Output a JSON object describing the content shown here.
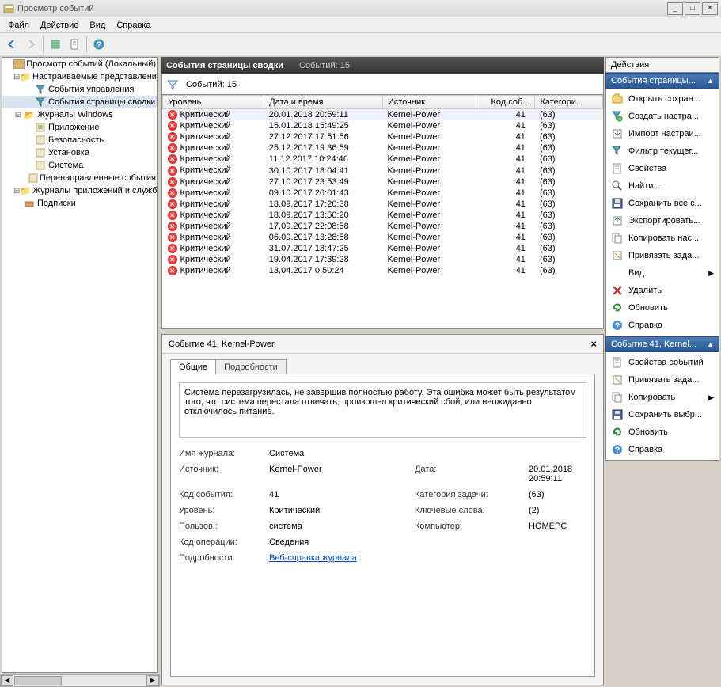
{
  "window": {
    "title": "Просмотр событий"
  },
  "menu": {
    "file": "Файл",
    "action": "Действие",
    "view": "Вид",
    "help": "Справка"
  },
  "tree": {
    "root": "Просмотр событий (Локальный)",
    "custom_views": "Настраиваемые представления",
    "admin_events": "События управления",
    "summary_events": "События страницы сводки",
    "windows_logs": "Журналы Windows",
    "application": "Приложение",
    "security": "Безопасность",
    "setup": "Установка",
    "system": "Система",
    "forwarded": "Перенаправленные события",
    "apps_services": "Журналы приложений и служб",
    "subscriptions": "Подписки"
  },
  "header": {
    "title": "События страницы сводки",
    "count_label": "Событий: 15"
  },
  "filter": {
    "count_label": "Событий: 15"
  },
  "columns": {
    "level": "Уровень",
    "datetime": "Дата и время",
    "source": "Источник",
    "event_id": "Код соб...",
    "category": "Категори..."
  },
  "rows": [
    {
      "level": "Критический",
      "datetime": "20.01.2018 20:59:11",
      "source": "Kernel-Power",
      "event_id": "41",
      "category": "(63)"
    },
    {
      "level": "Критический",
      "datetime": "15.01.2018 15:49:25",
      "source": "Kernel-Power",
      "event_id": "41",
      "category": "(63)"
    },
    {
      "level": "Критический",
      "datetime": "27.12.2017 17:51:56",
      "source": "Kernel-Power",
      "event_id": "41",
      "category": "(63)"
    },
    {
      "level": "Критический",
      "datetime": "25.12.2017 19:36:59",
      "source": "Kernel-Power",
      "event_id": "41",
      "category": "(63)"
    },
    {
      "level": "Критический",
      "datetime": "11.12.2017 10:24:46",
      "source": "Kernel-Power",
      "event_id": "41",
      "category": "(63)"
    },
    {
      "level": "Критический",
      "datetime": "30.10.2017 18:04:41",
      "source": "Kernel-Power",
      "event_id": "41",
      "category": "(63)"
    },
    {
      "level": "Критический",
      "datetime": "27.10.2017 23:53:49",
      "source": "Kernel-Power",
      "event_id": "41",
      "category": "(63)"
    },
    {
      "level": "Критический",
      "datetime": "09.10.2017 20:01:43",
      "source": "Kernel-Power",
      "event_id": "41",
      "category": "(63)"
    },
    {
      "level": "Критический",
      "datetime": "18.09.2017 17:20:38",
      "source": "Kernel-Power",
      "event_id": "41",
      "category": "(63)"
    },
    {
      "level": "Критический",
      "datetime": "18.09.2017 13:50:20",
      "source": "Kernel-Power",
      "event_id": "41",
      "category": "(63)"
    },
    {
      "level": "Критический",
      "datetime": "17.09.2017 22:08:58",
      "source": "Kernel-Power",
      "event_id": "41",
      "category": "(63)"
    },
    {
      "level": "Критический",
      "datetime": "06.09.2017 13:28:58",
      "source": "Kernel-Power",
      "event_id": "41",
      "category": "(63)"
    },
    {
      "level": "Критический",
      "datetime": "31.07.2017 18:47:25",
      "source": "Kernel-Power",
      "event_id": "41",
      "category": "(63)"
    },
    {
      "level": "Критический",
      "datetime": "19.04.2017 17:39:28",
      "source": "Kernel-Power",
      "event_id": "41",
      "category": "(63)"
    },
    {
      "level": "Критический",
      "datetime": "13.04.2017 0:50:24",
      "source": "Kernel-Power",
      "event_id": "41",
      "category": "(63)"
    }
  ],
  "detail": {
    "title": "Событие 41, Kernel-Power",
    "tab_general": "Общие",
    "tab_details": "Подробности",
    "description": "Система перезагрузилась, не завершив полностью работу. Эта ошибка может быть результатом того, что система перестала отвечать, произошел критический сбой, или неожиданно отключилось питание.",
    "labels": {
      "log_name": "Имя журнала:",
      "source": "Источник:",
      "event_id": "Код события:",
      "level": "Уровень:",
      "user": "Пользов.:",
      "opcode": "Код операции:",
      "more": "Подробности:",
      "date": "Дата:",
      "task_cat": "Категория задачи:",
      "keywords": "Ключевые слова:",
      "computer": "Компьютер:"
    },
    "values": {
      "log_name": "Система",
      "source": "Kernel-Power",
      "event_id": "41",
      "level": "Критический",
      "user": "система",
      "opcode": "Сведения",
      "more_link": "Веб-справка журнала",
      "date": "20.01.2018 20:59:11",
      "task_cat": "(63)",
      "keywords": "(2)",
      "computer": "HOMEPC"
    }
  },
  "actions": {
    "title": "Действия",
    "section1": "События страницы...",
    "items1": [
      "Открыть сохран...",
      "Создать настра...",
      "Импорт настраи...",
      "Фильтр текущег...",
      "Свойства",
      "Найти...",
      "Сохранить все с...",
      "Экспортировать...",
      "Копировать нас...",
      "Привязать зада...",
      "Вид",
      "Удалить",
      "Обновить",
      "Справка"
    ],
    "section2": "Событие 41, Kernel...",
    "items2": [
      "Свойства событий",
      "Привязать зада...",
      "Копировать",
      "Сохранить выбр...",
      "Обновить",
      "Справка"
    ]
  }
}
